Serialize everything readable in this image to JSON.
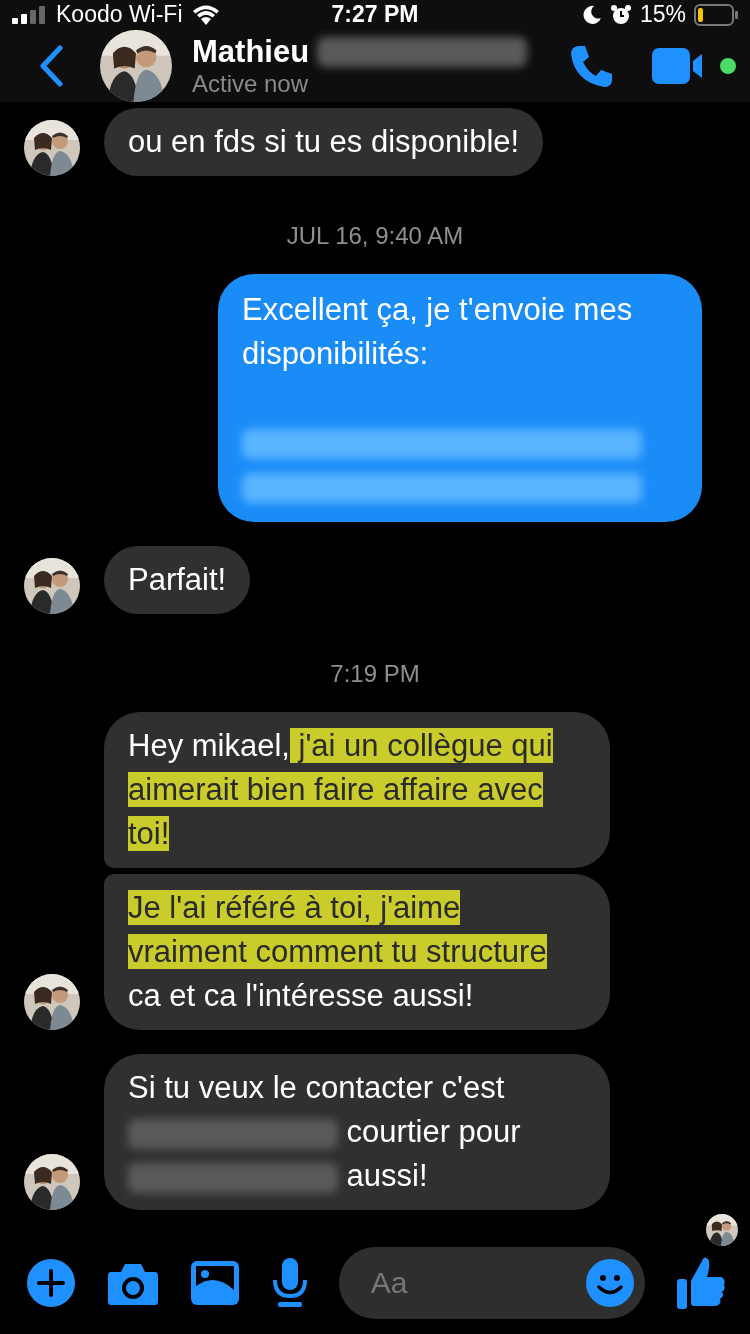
{
  "status_bar": {
    "carrier": "Koodo Wi-Fi",
    "time": "7:27 PM",
    "battery": "15%"
  },
  "header": {
    "name": "Mathieu",
    "name_redacted": true,
    "status": "Active now"
  },
  "messages": [
    {
      "kind": "incoming",
      "avatar": true,
      "bubbles": [
        {
          "segments": [
            {
              "kind": "text",
              "text": "ou en fds si tu es disponible!",
              "highlighted": false
            }
          ]
        }
      ]
    },
    {
      "kind": "timestamp",
      "text": "JUL 16, 9:40 AM"
    },
    {
      "kind": "outgoing",
      "bubbles": [
        {
          "segments": [
            {
              "kind": "text",
              "text": "Excellent ça, je t'envoie mes disponibilités:",
              "highlighted": false
            },
            {
              "kind": "break"
            },
            {
              "kind": "break"
            },
            {
              "kind": "redacted"
            },
            {
              "kind": "break"
            },
            {
              "kind": "redacted"
            }
          ]
        }
      ]
    },
    {
      "kind": "incoming",
      "avatar": true,
      "bubbles": [
        {
          "segments": [
            {
              "kind": "text",
              "text": "Parfait!",
              "highlighted": false
            }
          ]
        }
      ]
    },
    {
      "kind": "timestamp",
      "text": "7:19 PM"
    },
    {
      "kind": "incoming",
      "avatar": true,
      "bubbles": [
        {
          "segments": [
            {
              "kind": "text",
              "text": "Hey mikael,",
              "highlighted": false
            },
            {
              "kind": "text",
              "text": " j'ai un collègue qui aimerait bien faire affaire avec toi!",
              "highlighted": true
            }
          ]
        },
        {
          "segments": [
            {
              "kind": "text",
              "text": "Je l'ai référé à toi, j'aime vraiment comment tu structure",
              "highlighted": true
            },
            {
              "kind": "text",
              "text": " ca et ca l'intéresse aussi!",
              "highlighted": false
            }
          ]
        }
      ]
    },
    {
      "kind": "incoming",
      "avatar": true,
      "bubbles": [
        {
          "segments": [
            {
              "kind": "text",
              "text": "Si tu veux le contacter c'est ",
              "highlighted": false
            },
            {
              "kind": "redacted"
            },
            {
              "kind": "text",
              "text": " courtier pour ",
              "highlighted": false
            },
            {
              "kind": "redacted"
            },
            {
              "kind": "text",
              "text": " aussi!",
              "highlighted": false
            }
          ]
        }
      ]
    }
  ],
  "read_receipt": true,
  "composer": {
    "placeholder": "Aa"
  }
}
